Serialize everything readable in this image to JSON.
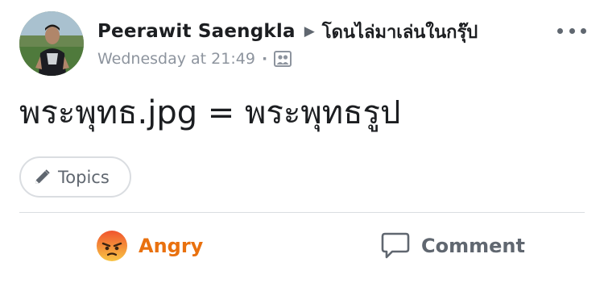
{
  "post": {
    "author": "Peerawit Saengkla",
    "separator_icon": "triangle-right-icon",
    "group": "โดนไล่มาเล่นในกรุ๊ป",
    "timestamp": "Wednesday at 21:49",
    "dot": "·",
    "audience_icon": "group-audience-icon",
    "menu_icon": "more-dots-icon",
    "text": "พระพุทธ.jpg = พระพุทธรูป"
  },
  "topics": {
    "icon": "pencil-icon",
    "label": "Topics"
  },
  "actions": {
    "reaction": {
      "label": "Angry",
      "icon": "angry-face-icon",
      "color": "#e9710f"
    },
    "comment": {
      "label": "Comment",
      "icon": "comment-bubble-icon",
      "color": "#606770"
    }
  },
  "colors": {
    "primary_text": "#1c1e21",
    "secondary_text": "#8d949e",
    "icon_gray": "#606770",
    "divider": "#dadde1"
  }
}
